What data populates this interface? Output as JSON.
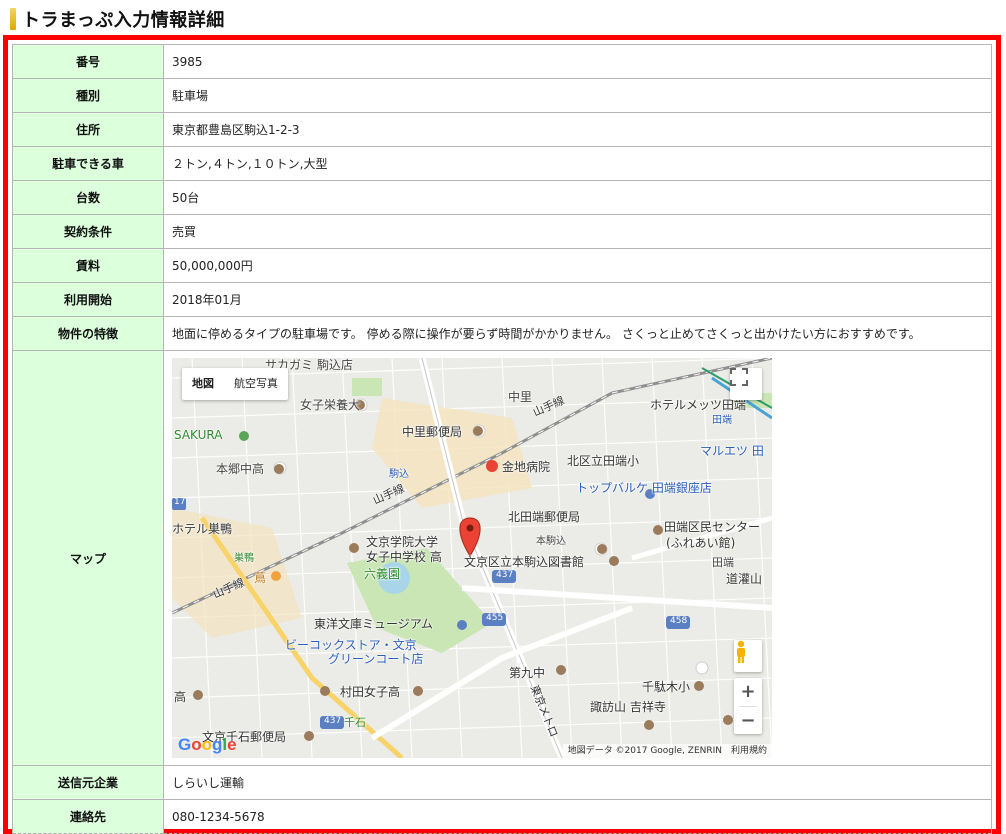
{
  "page": {
    "title": "トラまっぷ入力情報詳細"
  },
  "rows": [
    {
      "label": "番号",
      "value": "3985"
    },
    {
      "label": "種別",
      "value": "駐車場"
    },
    {
      "label": "住所",
      "value": "東京都豊島区駒込1-2-3"
    },
    {
      "label": "駐車できる車",
      "value": "２トン,４トン,１０トン,大型"
    },
    {
      "label": "台数",
      "value": "50台"
    },
    {
      "label": "契約条件",
      "value": "売買"
    },
    {
      "label": "賃料",
      "value": "50,000,000円"
    },
    {
      "label": "利用開始",
      "value": "2018年01月"
    },
    {
      "label": "物件の特徴",
      "value": "地面に停めるタイプの駐車場です。 停める際に操作が要らず時間がかかりません。 さくっと止めてさくっと出かけたい方におすすめです。"
    }
  ],
  "map_row": {
    "label": "マップ"
  },
  "rows_after": [
    {
      "label": "送信元企業",
      "value": "しらいし運輸"
    },
    {
      "label": "連絡先",
      "value": "080-1234-5678"
    }
  ],
  "map": {
    "type_buttons": {
      "map": "地図",
      "satellite": "航空写真"
    },
    "zoom_in": "+",
    "zoom_out": "−",
    "attribution": "地図データ ©2017 Google, ZENRIN　利用規約",
    "google_logo": [
      "G",
      "o",
      "o",
      "g",
      "l",
      "e"
    ],
    "labels": {
      "l1": "サカガミ 駒込店",
      "l2": "女子栄養大",
      "l3": "SAKURA",
      "l4": "中里郵便局",
      "l5": "中里",
      "l6": "ホテルメッツ田端",
      "l7": "田端",
      "l8": "本郷中高",
      "l9": "駒込",
      "l10": "金地病院",
      "l11": "北区立田端小",
      "l12": "マルエツ 田",
      "l13": "トップバルケ 田端銀座店",
      "l14": "北田端郵便局",
      "l15": "本駒込",
      "l16": "田端区民センター",
      "l17": "(ふれあい館)",
      "l18": "ホテル巣鴨",
      "l19": "文京学院大学",
      "l20": "女子中学校 高",
      "l21": "文京区立本駒込図書館",
      "l22": "田端",
      "l23": "道灌山",
      "l24": "巣鴨",
      "l25": "六義園",
      "l26": "蔦",
      "l27": "東洋文庫ミュージアム",
      "l28": "ビーコックストア・文京",
      "l29": "グリーンコート店",
      "l30": "第九中",
      "l31": "千駄木小",
      "l32": "諏訪山 吉祥寺",
      "l33": "村田女子高",
      "l34": "高",
      "l35": "千石",
      "l36": "文京千石郵便局",
      "l37": "文",
      "l38": "山手線",
      "l39": "山手線",
      "l40": "山手線",
      "l41": "東京メトロ",
      "l42": "17",
      "l43": "437",
      "l44": "455",
      "l45": "458",
      "l46": "437"
    }
  }
}
